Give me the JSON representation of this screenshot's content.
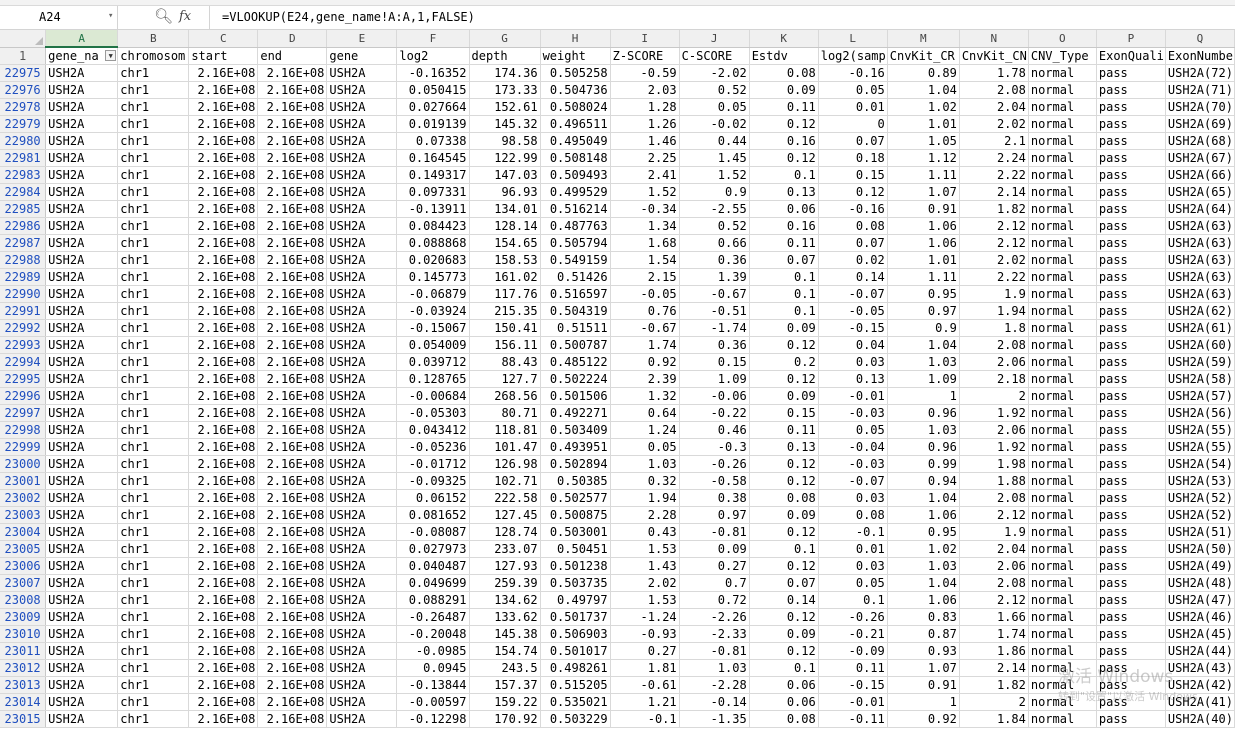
{
  "formula_bar": {
    "name_box": "A24",
    "zoom_icon": "magnifier-icon",
    "fx_label": "fx",
    "formula": "=VLOOKUP(E24,gene_name!A:A,1,FALSE)"
  },
  "columns": [
    "A",
    "B",
    "C",
    "D",
    "E",
    "F",
    "G",
    "H",
    "I",
    "J",
    "K",
    "L",
    "M",
    "N",
    "O",
    "P",
    "Q"
  ],
  "header_row_number": "1",
  "headers": [
    "gene_na",
    "chromosom",
    "start",
    "end",
    "gene",
    "log2",
    "depth",
    "weight",
    "Z-SCORE",
    "C-SCORE",
    "Estdv",
    "log2(samp",
    "CnvKit_CR",
    "CnvKit_CN",
    "CNV_Type",
    "ExonQuali",
    "ExonNumber"
  ],
  "rows": [
    {
      "n": "22975",
      "log2": "-0.16352",
      "depth": "174.36",
      "weight": "0.505258",
      "z": "-0.59",
      "c": "-2.02",
      "estdv": "0.08",
      "log2s": "-0.16",
      "cr": "0.89",
      "cn": "1.78",
      "exon": "USH2A(72)"
    },
    {
      "n": "22976",
      "log2": "0.050415",
      "depth": "173.33",
      "weight": "0.504736",
      "z": "2.03",
      "c": "0.52",
      "estdv": "0.09",
      "log2s": "0.05",
      "cr": "1.04",
      "cn": "2.08",
      "exon": "USH2A(71)"
    },
    {
      "n": "22978",
      "log2": "0.027664",
      "depth": "152.61",
      "weight": "0.508024",
      "z": "1.28",
      "c": "0.05",
      "estdv": "0.11",
      "log2s": "0.01",
      "cr": "1.02",
      "cn": "2.04",
      "exon": "USH2A(70)"
    },
    {
      "n": "22979",
      "log2": "0.019139",
      "depth": "145.32",
      "weight": "0.496511",
      "z": "1.26",
      "c": "-0.02",
      "estdv": "0.12",
      "log2s": "0",
      "cr": "1.01",
      "cn": "2.02",
      "exon": "USH2A(69)"
    },
    {
      "n": "22980",
      "log2": "0.07338",
      "depth": "98.58",
      "weight": "0.495049",
      "z": "1.46",
      "c": "0.44",
      "estdv": "0.16",
      "log2s": "0.07",
      "cr": "1.05",
      "cn": "2.1",
      "exon": "USH2A(68)"
    },
    {
      "n": "22981",
      "log2": "0.164545",
      "depth": "122.99",
      "weight": "0.508148",
      "z": "2.25",
      "c": "1.45",
      "estdv": "0.12",
      "log2s": "0.18",
      "cr": "1.12",
      "cn": "2.24",
      "exon": "USH2A(67)"
    },
    {
      "n": "22983",
      "log2": "0.149317",
      "depth": "147.03",
      "weight": "0.509493",
      "z": "2.41",
      "c": "1.52",
      "estdv": "0.1",
      "log2s": "0.15",
      "cr": "1.11",
      "cn": "2.22",
      "exon": "USH2A(66)"
    },
    {
      "n": "22984",
      "log2": "0.097331",
      "depth": "96.93",
      "weight": "0.499529",
      "z": "1.52",
      "c": "0.9",
      "estdv": "0.13",
      "log2s": "0.12",
      "cr": "1.07",
      "cn": "2.14",
      "exon": "USH2A(65)"
    },
    {
      "n": "22985",
      "log2": "-0.13911",
      "depth": "134.01",
      "weight": "0.516214",
      "z": "-0.34",
      "c": "-2.55",
      "estdv": "0.06",
      "log2s": "-0.16",
      "cr": "0.91",
      "cn": "1.82",
      "exon": "USH2A(64)"
    },
    {
      "n": "22986",
      "log2": "0.084423",
      "depth": "128.14",
      "weight": "0.487763",
      "z": "1.34",
      "c": "0.52",
      "estdv": "0.16",
      "log2s": "0.08",
      "cr": "1.06",
      "cn": "2.12",
      "exon": "USH2A(63)"
    },
    {
      "n": "22987",
      "log2": "0.088868",
      "depth": "154.65",
      "weight": "0.505794",
      "z": "1.68",
      "c": "0.66",
      "estdv": "0.11",
      "log2s": "0.07",
      "cr": "1.06",
      "cn": "2.12",
      "exon": "USH2A(63)"
    },
    {
      "n": "22988",
      "log2": "0.020683",
      "depth": "158.53",
      "weight": "0.549159",
      "z": "1.54",
      "c": "0.36",
      "estdv": "0.07",
      "log2s": "0.02",
      "cr": "1.01",
      "cn": "2.02",
      "exon": "USH2A(63)"
    },
    {
      "n": "22989",
      "log2": "0.145773",
      "depth": "161.02",
      "weight": "0.51426",
      "z": "2.15",
      "c": "1.39",
      "estdv": "0.1",
      "log2s": "0.14",
      "cr": "1.11",
      "cn": "2.22",
      "exon": "USH2A(63)"
    },
    {
      "n": "22990",
      "log2": "-0.06879",
      "depth": "117.76",
      "weight": "0.516597",
      "z": "-0.05",
      "c": "-0.67",
      "estdv": "0.1",
      "log2s": "-0.07",
      "cr": "0.95",
      "cn": "1.9",
      "exon": "USH2A(63)"
    },
    {
      "n": "22991",
      "log2": "-0.03924",
      "depth": "215.35",
      "weight": "0.504319",
      "z": "0.76",
      "c": "-0.51",
      "estdv": "0.1",
      "log2s": "-0.05",
      "cr": "0.97",
      "cn": "1.94",
      "exon": "USH2A(62)"
    },
    {
      "n": "22992",
      "log2": "-0.15067",
      "depth": "150.41",
      "weight": "0.51511",
      "z": "-0.67",
      "c": "-1.74",
      "estdv": "0.09",
      "log2s": "-0.15",
      "cr": "0.9",
      "cn": "1.8",
      "exon": "USH2A(61)"
    },
    {
      "n": "22993",
      "log2": "0.054009",
      "depth": "156.11",
      "weight": "0.500787",
      "z": "1.74",
      "c": "0.36",
      "estdv": "0.12",
      "log2s": "0.04",
      "cr": "1.04",
      "cn": "2.08",
      "exon": "USH2A(60)"
    },
    {
      "n": "22994",
      "log2": "0.039712",
      "depth": "88.43",
      "weight": "0.485122",
      "z": "0.92",
      "c": "0.15",
      "estdv": "0.2",
      "log2s": "0.03",
      "cr": "1.03",
      "cn": "2.06",
      "exon": "USH2A(59)"
    },
    {
      "n": "22995",
      "log2": "0.128765",
      "depth": "127.7",
      "weight": "0.502224",
      "z": "2.39",
      "c": "1.09",
      "estdv": "0.12",
      "log2s": "0.13",
      "cr": "1.09",
      "cn": "2.18",
      "exon": "USH2A(58)"
    },
    {
      "n": "22996",
      "log2": "-0.00684",
      "depth": "268.56",
      "weight": "0.501506",
      "z": "1.32",
      "c": "-0.06",
      "estdv": "0.09",
      "log2s": "-0.01",
      "cr": "1",
      "cn": "2",
      "exon": "USH2A(57)"
    },
    {
      "n": "22997",
      "log2": "-0.05303",
      "depth": "80.71",
      "weight": "0.492271",
      "z": "0.64",
      "c": "-0.22",
      "estdv": "0.15",
      "log2s": "-0.03",
      "cr": "0.96",
      "cn": "1.92",
      "exon": "USH2A(56)"
    },
    {
      "n": "22998",
      "log2": "0.043412",
      "depth": "118.81",
      "weight": "0.503409",
      "z": "1.24",
      "c": "0.46",
      "estdv": "0.11",
      "log2s": "0.05",
      "cr": "1.03",
      "cn": "2.06",
      "exon": "USH2A(55)"
    },
    {
      "n": "22999",
      "log2": "-0.05236",
      "depth": "101.47",
      "weight": "0.493951",
      "z": "0.05",
      "c": "-0.3",
      "estdv": "0.13",
      "log2s": "-0.04",
      "cr": "0.96",
      "cn": "1.92",
      "exon": "USH2A(55)"
    },
    {
      "n": "23000",
      "log2": "-0.01712",
      "depth": "126.98",
      "weight": "0.502894",
      "z": "1.03",
      "c": "-0.26",
      "estdv": "0.12",
      "log2s": "-0.03",
      "cr": "0.99",
      "cn": "1.98",
      "exon": "USH2A(54)"
    },
    {
      "n": "23001",
      "log2": "-0.09325",
      "depth": "102.71",
      "weight": "0.50385",
      "z": "0.32",
      "c": "-0.58",
      "estdv": "0.12",
      "log2s": "-0.07",
      "cr": "0.94",
      "cn": "1.88",
      "exon": "USH2A(53)"
    },
    {
      "n": "23002",
      "log2": "0.06152",
      "depth": "222.58",
      "weight": "0.502577",
      "z": "1.94",
      "c": "0.38",
      "estdv": "0.08",
      "log2s": "0.03",
      "cr": "1.04",
      "cn": "2.08",
      "exon": "USH2A(52)"
    },
    {
      "n": "23003",
      "log2": "0.081652",
      "depth": "127.45",
      "weight": "0.500875",
      "z": "2.28",
      "c": "0.97",
      "estdv": "0.09",
      "log2s": "0.08",
      "cr": "1.06",
      "cn": "2.12",
      "exon": "USH2A(52)"
    },
    {
      "n": "23004",
      "log2": "-0.08087",
      "depth": "128.74",
      "weight": "0.503001",
      "z": "0.43",
      "c": "-0.81",
      "estdv": "0.12",
      "log2s": "-0.1",
      "cr": "0.95",
      "cn": "1.9",
      "exon": "USH2A(51)"
    },
    {
      "n": "23005",
      "log2": "0.027973",
      "depth": "233.07",
      "weight": "0.50451",
      "z": "1.53",
      "c": "0.09",
      "estdv": "0.1",
      "log2s": "0.01",
      "cr": "1.02",
      "cn": "2.04",
      "exon": "USH2A(50)"
    },
    {
      "n": "23006",
      "log2": "0.040487",
      "depth": "127.93",
      "weight": "0.501238",
      "z": "1.43",
      "c": "0.27",
      "estdv": "0.12",
      "log2s": "0.03",
      "cr": "1.03",
      "cn": "2.06",
      "exon": "USH2A(49)"
    },
    {
      "n": "23007",
      "log2": "0.049699",
      "depth": "259.39",
      "weight": "0.503735",
      "z": "2.02",
      "c": "0.7",
      "estdv": "0.07",
      "log2s": "0.05",
      "cr": "1.04",
      "cn": "2.08",
      "exon": "USH2A(48)"
    },
    {
      "n": "23008",
      "log2": "0.088291",
      "depth": "134.62",
      "weight": "0.49797",
      "z": "1.53",
      "c": "0.72",
      "estdv": "0.14",
      "log2s": "0.1",
      "cr": "1.06",
      "cn": "2.12",
      "exon": "USH2A(47)"
    },
    {
      "n": "23009",
      "log2": "-0.26487",
      "depth": "133.62",
      "weight": "0.501737",
      "z": "-1.24",
      "c": "-2.26",
      "estdv": "0.12",
      "log2s": "-0.26",
      "cr": "0.83",
      "cn": "1.66",
      "exon": "USH2A(46)"
    },
    {
      "n": "23010",
      "log2": "-0.20048",
      "depth": "145.38",
      "weight": "0.506903",
      "z": "-0.93",
      "c": "-2.33",
      "estdv": "0.09",
      "log2s": "-0.21",
      "cr": "0.87",
      "cn": "1.74",
      "exon": "USH2A(45)"
    },
    {
      "n": "23011",
      "log2": "-0.0985",
      "depth": "154.74",
      "weight": "0.501017",
      "z": "0.27",
      "c": "-0.81",
      "estdv": "0.12",
      "log2s": "-0.09",
      "cr": "0.93",
      "cn": "1.86",
      "exon": "USH2A(44)"
    },
    {
      "n": "23012",
      "log2": "0.0945",
      "depth": "243.5",
      "weight": "0.498261",
      "z": "1.81",
      "c": "1.03",
      "estdv": "0.1",
      "log2s": "0.11",
      "cr": "1.07",
      "cn": "2.14",
      "exon": "USH2A(43)"
    },
    {
      "n": "23013",
      "log2": "-0.13844",
      "depth": "157.37",
      "weight": "0.515205",
      "z": "-0.61",
      "c": "-2.28",
      "estdv": "0.06",
      "log2s": "-0.15",
      "cr": "0.91",
      "cn": "1.82",
      "exon": "USH2A(42)"
    },
    {
      "n": "23014",
      "log2": "-0.00597",
      "depth": "159.22",
      "weight": "0.535021",
      "z": "1.21",
      "c": "-0.14",
      "estdv": "0.06",
      "log2s": "-0.01",
      "cr": "1",
      "cn": "2",
      "exon": "USH2A(41)"
    },
    {
      "n": "23015",
      "log2": "-0.12298",
      "depth": "170.92",
      "weight": "0.503229",
      "z": "-0.1",
      "c": "-1.35",
      "estdv": "0.08",
      "log2s": "-0.11",
      "cr": "0.92",
      "cn": "1.84",
      "exon": "USH2A(40)"
    }
  ],
  "constant": {
    "gene_name": "USH2A",
    "chromosome": "chr1",
    "start": "2.16E+08",
    "end": "2.16E+08",
    "gene": "USH2A",
    "cnv_type": "normal",
    "exon_quality": "pass"
  },
  "watermark": {
    "line1": "激活 Windows",
    "line2": "转到\"设置\"以激活 Windows"
  }
}
